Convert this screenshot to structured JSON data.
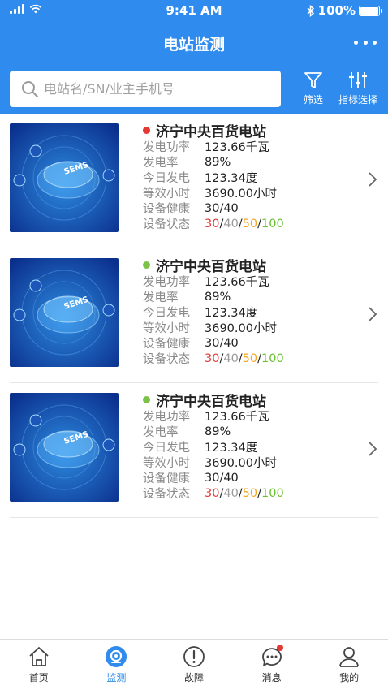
{
  "status_bar": {
    "time": "9:41 AM",
    "battery": "100%"
  },
  "header": {
    "title": "电站监测",
    "search_placeholder": "电站名/SN/业主手机号",
    "filter_label": "筛选",
    "metric_label": "指标选择"
  },
  "colors": {
    "primary": "#2f8cee",
    "status_red": "#e53935",
    "status_green": "#7cc24a",
    "status_yellow": "#f5a623"
  },
  "stations": [
    {
      "name": "济宁中央百货电站",
      "status_dot": "red",
      "labels": {
        "power": "发电功率",
        "rate": "发电率",
        "today": "今日发电",
        "hours": "等效小时",
        "health": "设备健康",
        "status": "设备状态"
      },
      "power": "123.66千瓦",
      "rate": "89%",
      "today": "123.34度",
      "hours": "3690.00小时",
      "health": "30/40",
      "status_values": [
        "30",
        "40",
        "50",
        "100"
      ],
      "image_text": "SEMS"
    },
    {
      "name": "济宁中央百货电站",
      "status_dot": "green",
      "labels": {
        "power": "发电功率",
        "rate": "发电率",
        "today": "今日发电",
        "hours": "等效小时",
        "health": "设备健康",
        "status": "设备状态"
      },
      "power": "123.66千瓦",
      "rate": "89%",
      "today": "123.34度",
      "hours": "3690.00小时",
      "health": "30/40",
      "status_values": [
        "30",
        "40",
        "50",
        "100"
      ],
      "image_text": "SEMS"
    },
    {
      "name": "济宁中央百货电站",
      "status_dot": "green",
      "labels": {
        "power": "发电功率",
        "rate": "发电率",
        "today": "今日发电",
        "hours": "等效小时",
        "health": "设备健康",
        "status": "设备状态"
      },
      "power": "123.66千瓦",
      "rate": "89%",
      "today": "123.34度",
      "hours": "3690.00小时",
      "health": "30/40",
      "status_values": [
        "30",
        "40",
        "50",
        "100"
      ],
      "image_text": "SEMS"
    }
  ],
  "tabs": [
    {
      "label": "首页",
      "icon": "home-icon"
    },
    {
      "label": "监测",
      "icon": "monitor-icon",
      "active": true
    },
    {
      "label": "故障",
      "icon": "fault-icon"
    },
    {
      "label": "消息",
      "icon": "message-icon",
      "badge": true
    },
    {
      "label": "我的",
      "icon": "profile-icon"
    }
  ]
}
